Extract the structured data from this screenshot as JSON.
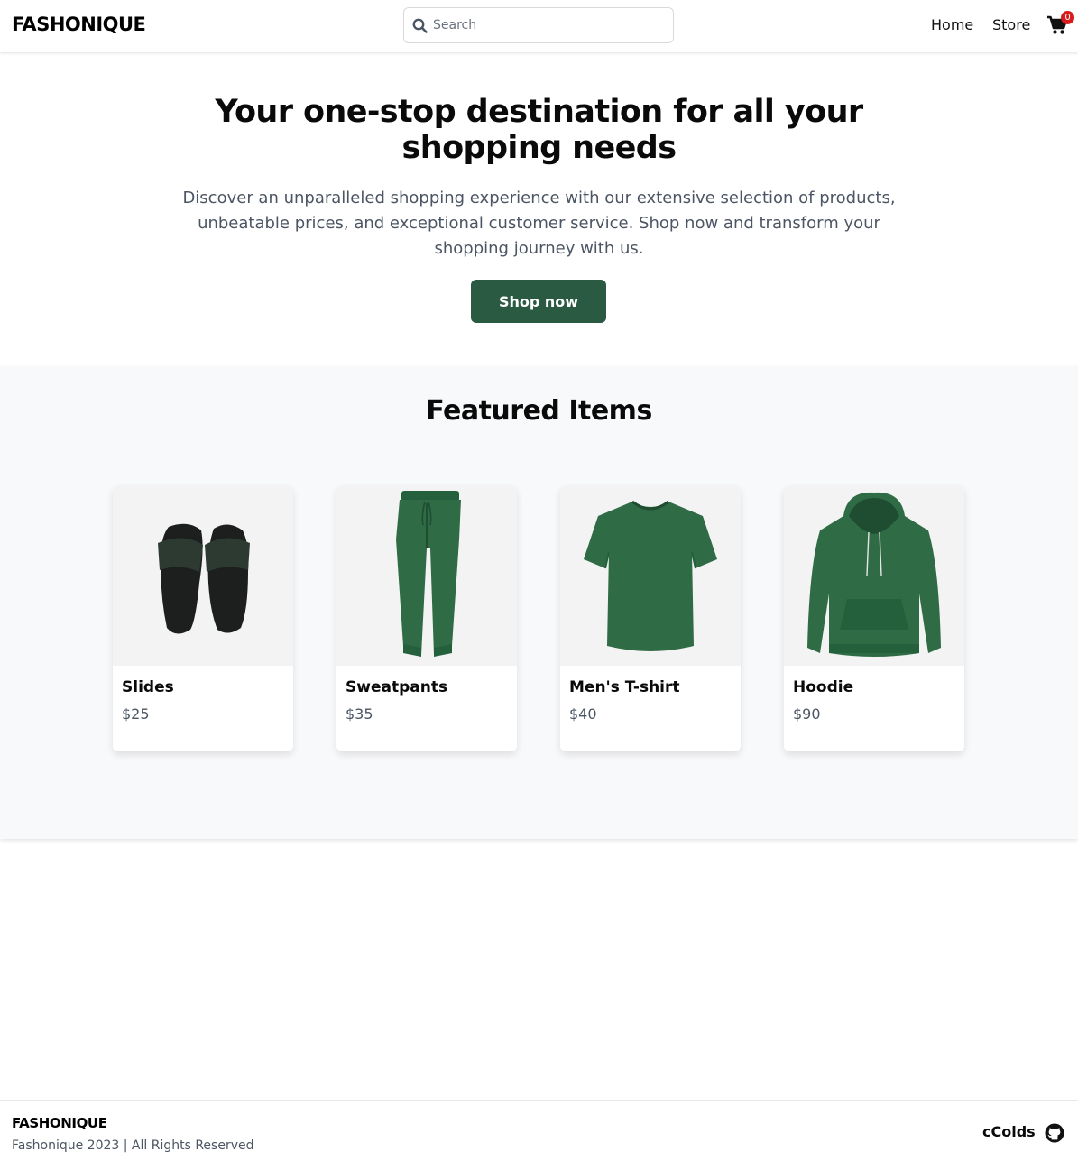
{
  "header": {
    "logo": "FASHONIQUE",
    "search_placeholder": "Search",
    "nav": [
      {
        "label": "Home"
      },
      {
        "label": "Store"
      }
    ],
    "cart_count": "0"
  },
  "hero": {
    "title": "Your one-stop destination for all your shopping needs",
    "description": "Discover an unparalleled shopping experience with our extensive selection of products, unbeatable prices, and exceptional customer service. Shop now and transform your shopping journey with us.",
    "cta_label": "Shop now"
  },
  "featured": {
    "title": "Featured Items",
    "items": [
      {
        "name": "Slides",
        "price": "$25",
        "image": "slides-image"
      },
      {
        "name": "Sweatpants",
        "price": "$35",
        "image": "sweatpants-image"
      },
      {
        "name": "Men's T-shirt",
        "price": "$40",
        "image": "tshirt-image"
      },
      {
        "name": "Hoodie",
        "price": "$90",
        "image": "hoodie-image"
      }
    ]
  },
  "footer": {
    "logo": "FASHONIQUE",
    "copyright": "Fashonique 2023 | All Rights Reserved",
    "author": "cColds"
  },
  "colors": {
    "primary_button": "#2a5a42",
    "product_green": "#2f6b45",
    "badge_red": "#d61c1c",
    "section_bg": "#f8f9fa"
  }
}
